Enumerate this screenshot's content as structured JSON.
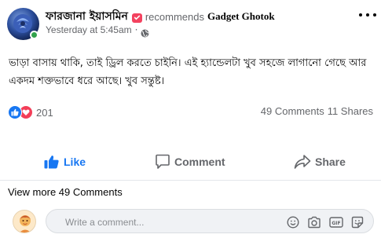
{
  "post": {
    "author": "ফারজানা ইয়াসমিন",
    "action_text": "recommends",
    "page_name": "Gadget Ghotok",
    "timestamp": "Yesterday at 5:45am",
    "separator": "·",
    "privacy_icon": "globe-icon",
    "text": "ভাড়া বাসায় থাকি, তাই ড্রিল করতে চাইনি। এই হ্যান্ডেলটা খুব সহজে লাগানো গেছে আর একদম শক্তভাবে ধরে আছে। খুব সন্তুষ্ট।",
    "reaction_count": "201",
    "comments_count": "49 Comments",
    "shares_count": "11 Shares"
  },
  "actions": {
    "like_label": "Like",
    "comment_label": "Comment",
    "share_label": "Share"
  },
  "comments": {
    "view_more": "View more 49 Comments",
    "placeholder": "Write a comment..."
  },
  "colors": {
    "like_blue": "#1877f2",
    "love_red": "#f33e58",
    "recommend_red": "#f3425f",
    "online_green": "#31a24c",
    "muted_text": "#65676b"
  }
}
